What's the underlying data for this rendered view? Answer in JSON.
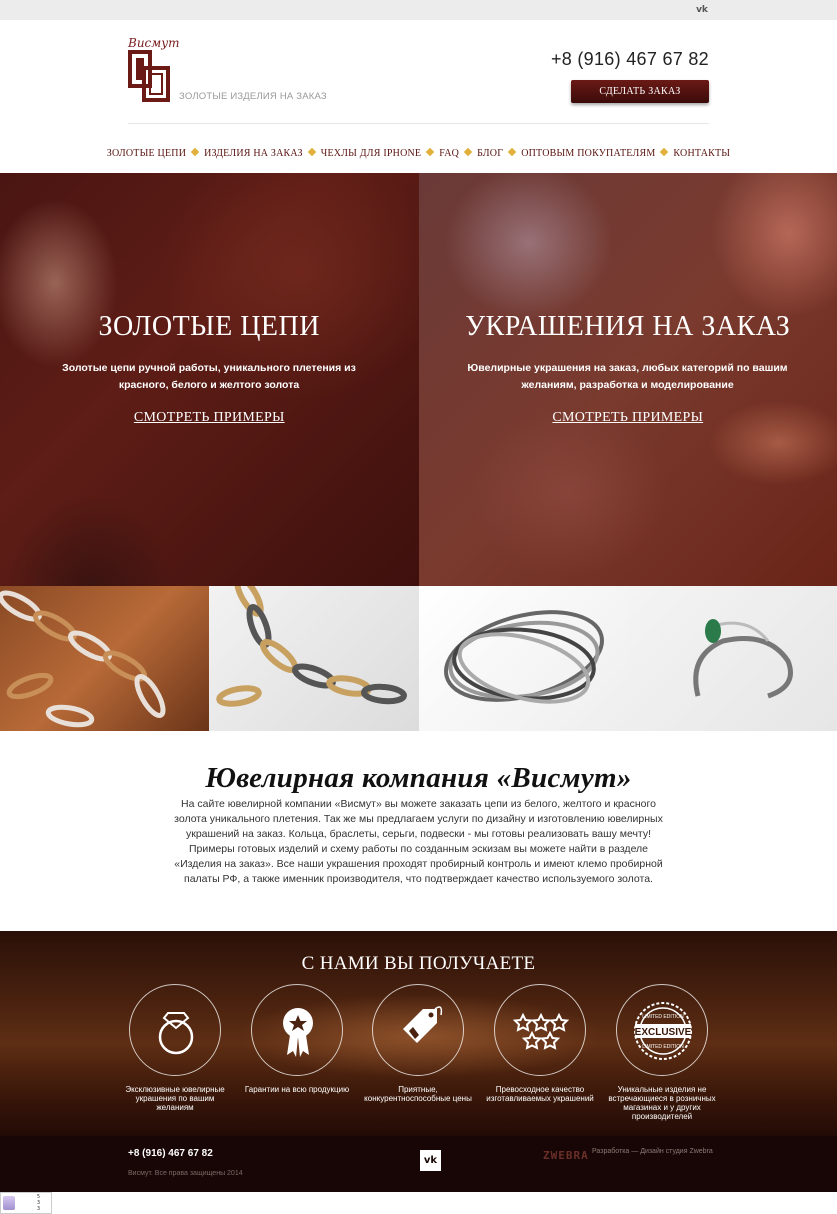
{
  "topbar": {
    "vk_icon": "vk-icon",
    "vk_text": "vk"
  },
  "header": {
    "logo_script": "Висмут",
    "tagline": "ЗОЛОТЫЕ ИЗДЕЛИЯ НА ЗАКАЗ",
    "phone": "+8 (916) 467 67 82",
    "order_button": "СДЕЛАТЬ ЗАКАЗ",
    "accent_color": "#5a1410"
  },
  "nav": {
    "items": [
      "ЗОЛОТЫЕ ЦЕПИ",
      "ИЗДЕЛИЯ НА ЗАКАЗ",
      "ЧЕХЛЫ ДЛЯ IPHONE",
      "FAQ",
      "БЛОГ",
      "ОПТОВЫМ ПОКУПАТЕЛЯМ",
      "КОНТАКТЫ"
    ]
  },
  "hero": [
    {
      "title": "ЗОЛОТЫЕ ЦЕПИ",
      "text": "Золотые цепи ручной работы, уникального плетения из красного, белого и желтого золота",
      "link": "СМОТРЕТЬ ПРИМЕРЫ"
    },
    {
      "title": "УКРАШЕНИЯ НА ЗАКАЗ",
      "text": "Ювелирные украшения на заказ, любых категорий по вашим желаниям, разработка и моделирование",
      "link": "СМОТРЕТЬ ПРИМЕРЫ"
    }
  ],
  "about": {
    "title": "Ювелирная компания «Висмут»",
    "text": "На сайте ювелирной компании «Висмут» вы можете заказать цепи из белого, желтого и красного золота уникального плетения. Так же мы предлагаем услуги по дизайну и изготовлению ювелирных украшений на заказ. Кольца, браслеты, серьги, подвески - мы готовы реализовать вашу мечту! Примеры готовых изделий и схему работы по созданным эскизам вы можете найти в разделе «Изделия на заказ». Все наши украшения проходят пробирный контроль и имеют клемо пробирной палаты РФ, а также именник производителя, что подтверждает качество используемого золота."
  },
  "benefits": {
    "title": "С НАМИ ВЫ ПОЛУЧАЕТЕ",
    "items": [
      {
        "icon": "diamond-ring-icon",
        "caption": "Эксклюзивные ювелирные украшения по вашим желаниям"
      },
      {
        "icon": "award-ribbon-icon",
        "caption": "Гарантии на всю продукцию"
      },
      {
        "icon": "price-tag-icon",
        "caption": "Приятные, конкурентноспособные цены"
      },
      {
        "icon": "five-stars-icon",
        "caption": "Превосходное качество изготавливаемых украшений"
      },
      {
        "icon": "exclusive-badge-icon",
        "caption": "Уникальные изделия не встречающиеся в розничных магазинах и у других производителей",
        "badge_top": "LIMITED EDITION",
        "badge_main": "EXCLUSIVE",
        "badge_bottom": "LIMITED EDITION"
      }
    ]
  },
  "footer": {
    "phone": "+8 (916) 467 67 82",
    "copyright": "Висмут. Все права защищены 2014",
    "vk_text": "vk",
    "studio_logo": "ZWEBRA",
    "developer": "Разработка — Дизайн студия Zwebra"
  },
  "widget": {
    "rows": [
      "5",
      "3",
      "3"
    ]
  }
}
